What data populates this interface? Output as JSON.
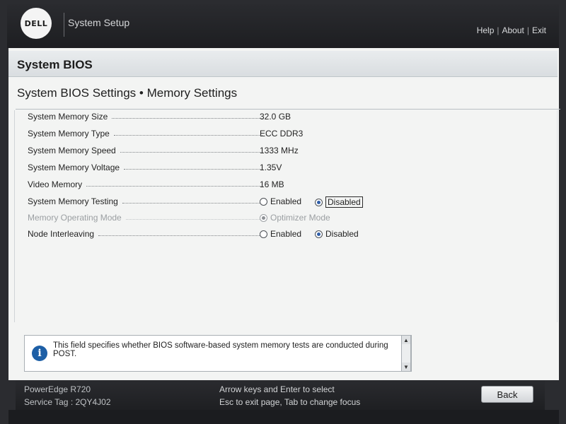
{
  "header": {
    "logo_text": "DELL",
    "app_title": "System Setup",
    "links": {
      "help": "Help",
      "about": "About",
      "exit": "Exit",
      "separator": "|"
    }
  },
  "section": {
    "title": "System BIOS"
  },
  "page": {
    "title": "System BIOS Settings • Memory Settings"
  },
  "settings": [
    {
      "label": "System Memory Size",
      "value": "32.0 GB"
    },
    {
      "label": "System Memory Type",
      "value": "ECC DDR3"
    },
    {
      "label": "System Memory Speed",
      "value": "1333 MHz"
    },
    {
      "label": "System Memory Voltage",
      "value": "1.35V"
    },
    {
      "label": "Video Memory",
      "value": "16 MB"
    },
    {
      "label": "System Memory Testing",
      "options": [
        "Enabled",
        "Disabled"
      ],
      "selected": "Disabled"
    },
    {
      "label": "Memory Operating Mode",
      "options": [
        "Optimizer Mode"
      ],
      "selected": "Optimizer Mode",
      "disabled": true
    },
    {
      "label": "Node Interleaving",
      "options": [
        "Enabled",
        "Disabled"
      ],
      "selected": "Disabled"
    }
  ],
  "help": {
    "icon": "info-icon",
    "text": "This field specifies whether BIOS software-based system memory tests are conducted during POST."
  },
  "footer": {
    "model": "PowerEdge R720",
    "service_tag": "Service Tag : 2QY4J02",
    "hint_line1": "Arrow keys and Enter to select",
    "hint_line2": "Esc to exit page, Tab to change focus",
    "back_label": "Back"
  },
  "colors": {
    "header_bg": "#1d1e21",
    "panel_bg": "#f3f4f3",
    "accent": "#1d5fa6"
  }
}
